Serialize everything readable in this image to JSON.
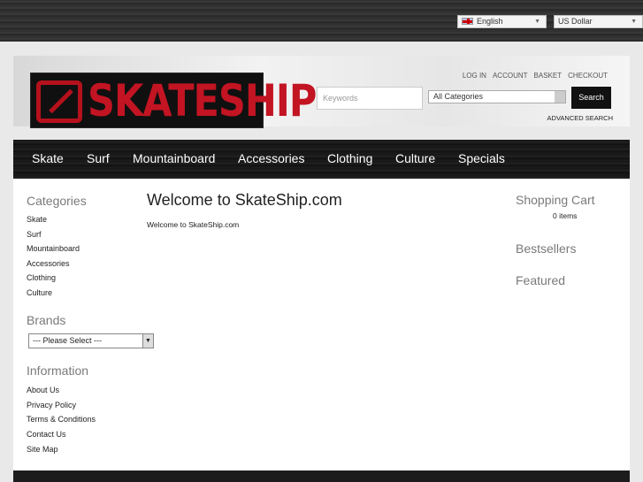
{
  "topbar": {
    "language": "English",
    "currency": "US Dollar"
  },
  "header": {
    "logo_text": "SKATESHIP",
    "links": [
      "LOG IN",
      "ACCOUNT",
      "BASKET",
      "CHECKOUT"
    ],
    "search_placeholder": "Keywords",
    "category_selected": "All Categories",
    "search_button": "Search",
    "advanced_search": "ADVANCED SEARCH",
    "accent_color": "#c21422"
  },
  "nav": [
    "Skate",
    "Surf",
    "Mountainboard",
    "Accessories",
    "Clothing",
    "Culture",
    "Specials"
  ],
  "left": {
    "categories_heading": "Categories",
    "categories": [
      "Skate",
      "Surf",
      "Mountainboard",
      "Accessories",
      "Clothing",
      "Culture"
    ],
    "brands_heading": "Brands",
    "brand_select": "--- Please Select ---",
    "information_heading": "Information",
    "information": [
      "About Us",
      "Privacy Policy",
      "Terms & Conditions",
      "Contact Us",
      "Site Map"
    ]
  },
  "content": {
    "title": "Welcome to SkateShip.com",
    "text": "Welcome to SkateShip.com"
  },
  "right": {
    "cart_heading": "Shopping Cart",
    "cart_count": "0 items",
    "bestsellers_heading": "Bestsellers",
    "featured_heading": "Featured"
  }
}
